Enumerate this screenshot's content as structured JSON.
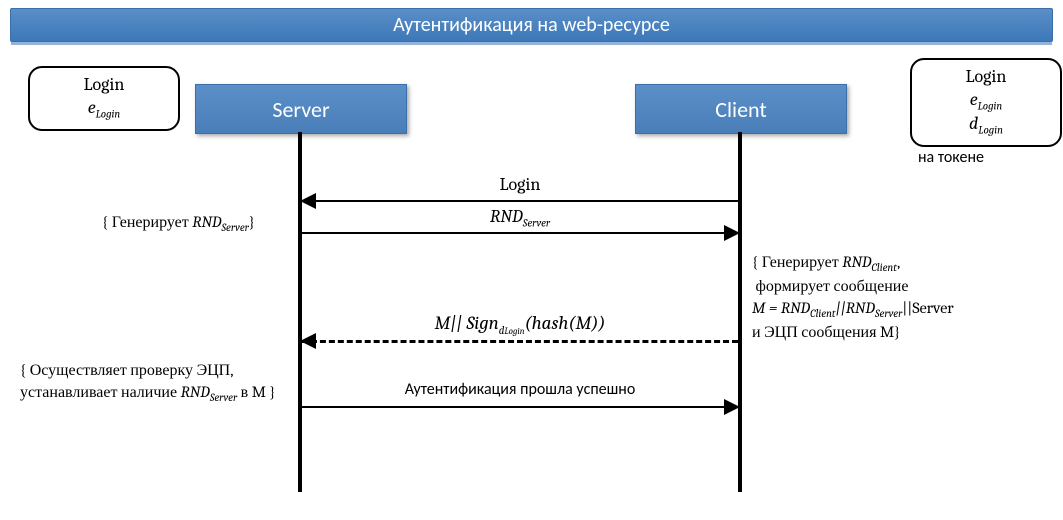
{
  "title": "Аутентификация на web-ресурсе",
  "left_box": {
    "line1": "Login",
    "line2_prefix": "e",
    "line2_sub": "Login"
  },
  "right_box": {
    "line1": "Login",
    "line2_prefix": "e",
    "line2_sub": "Login",
    "line3_prefix": "d",
    "line3_sub": "Login",
    "footer": "на токене"
  },
  "participants": {
    "server": "Server",
    "client": "Client"
  },
  "messages": {
    "m1": "Login",
    "m2_prefix": "RND",
    "m2_sub": "Server",
    "m3_full": "M|| Sign",
    "m3_signsub": "d_Login",
    "m3_tail": "(hash(M))",
    "m4": "Аутентификация прошла успешно"
  },
  "notes": {
    "n_server_gen_open": "{ Генерирует ",
    "n_server_gen_rnd": "RND",
    "n_server_gen_sub": "Server",
    "n_server_gen_close": "}",
    "n_client_gen_l1a": "{ Генерирует ",
    "n_client_gen_l1b": "RND",
    "n_client_gen_l1c": "Client",
    "n_client_gen_l1d": ",",
    "n_client_l2": "формирует сообщение",
    "n_client_l3_a": "M = RND",
    "n_client_l3_b": "Client",
    "n_client_l3_c": "||RND",
    "n_client_l3_d": "Server",
    "n_client_l3_e": "||Server",
    "n_client_l4": "и ЭЦП сообщения M}",
    "n_verify_l1": "{ Осуществляет проверку  ЭЦП,",
    "n_verify_l2a": "устанавливает наличие ",
    "n_verify_l2b": "RND",
    "n_verify_l2c": "Server",
    "n_verify_l2d": " в M }"
  },
  "chart_data": {
    "type": "sequence",
    "title": "Аутентификация на web-ресурсе",
    "participants": [
      "Server",
      "Client"
    ],
    "knowledge": {
      "Server": [
        "Login",
        "e_Login"
      ],
      "Client": [
        "Login",
        "e_Login",
        "d_Login (на токене)"
      ]
    },
    "messages": [
      {
        "from": "Client",
        "to": "Server",
        "label": "Login",
        "style": "solid"
      },
      {
        "from": "Server",
        "to": "Client",
        "label": "RND_Server",
        "style": "solid",
        "server_action": "Генерирует RND_Server"
      },
      {
        "from": "Client",
        "to": "Server",
        "label": "M || Sign_{d_Login}(hash(M))",
        "style": "dashed",
        "client_action": "Генерирует RND_Client, формирует сообщение M = RND_Client || RND_Server || Server и ЭЦП сообщения M"
      },
      {
        "from": "Server",
        "to": "Client",
        "label": "Аутентификация прошла успешно",
        "style": "solid",
        "server_action": "Осуществляет проверку ЭЦП, устанавливает наличие RND_Server в M"
      }
    ]
  }
}
